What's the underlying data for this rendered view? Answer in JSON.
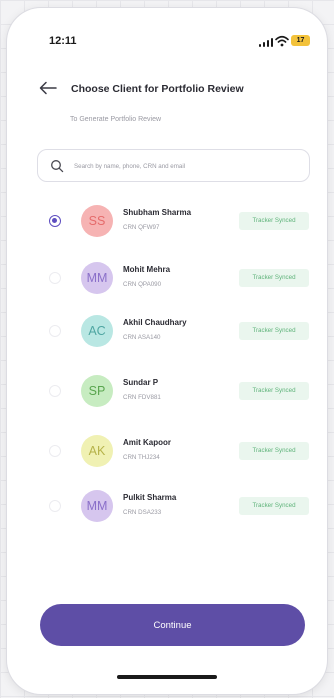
{
  "status_bar": {
    "time": "12:11",
    "battery": "17",
    "icons": [
      "signal-icon",
      "wifi-icon",
      "battery-icon"
    ]
  },
  "header": {
    "back_icon": "arrow-left-icon",
    "title": "Choose Client for Portfolio Review",
    "subtitle": "To Generate Portfolio Review"
  },
  "search": {
    "icon": "search-icon",
    "placeholder": "Search by name, phone, CRN and email",
    "value": ""
  },
  "clients": [
    {
      "initials": "SS",
      "name": "Shubham Sharma",
      "crn": "CRN QFW97",
      "badge": "Tracker Synced",
      "selected": true
    },
    {
      "initials": "MM",
      "name": "Mohit Mehra",
      "crn": "CRN QPA090",
      "badge": "Tracker Synced",
      "selected": false
    },
    {
      "initials": "AC",
      "name": "Akhil Chaudhary",
      "crn": "CRN ASA140",
      "badge": "Tracker Synced",
      "selected": false
    },
    {
      "initials": "SP",
      "name": "Sundar P",
      "crn": "CRN FDV881",
      "badge": "Tracker Synced",
      "selected": false
    },
    {
      "initials": "AK",
      "name": "Amit Kapoor",
      "crn": "CRN THJ234",
      "badge": "Tracker Synced",
      "selected": false
    },
    {
      "initials": "MM",
      "name": "Pulkit Sharma",
      "crn": "CRN DSA233",
      "badge": "Tracker Synced",
      "selected": false
    }
  ],
  "actions": {
    "continue_label": "Continue"
  },
  "colors": {
    "accent": "#5e4ea6",
    "avatar_red": "#f6b3b3",
    "avatar_purple": "#d6c6ee",
    "avatar_teal": "#b9e7e3",
    "avatar_green": "#c7ecc1",
    "avatar_yellow": "#f0f1b3",
    "badge_bg": "#eaf6ee",
    "badge_text": "#5fb37a"
  }
}
